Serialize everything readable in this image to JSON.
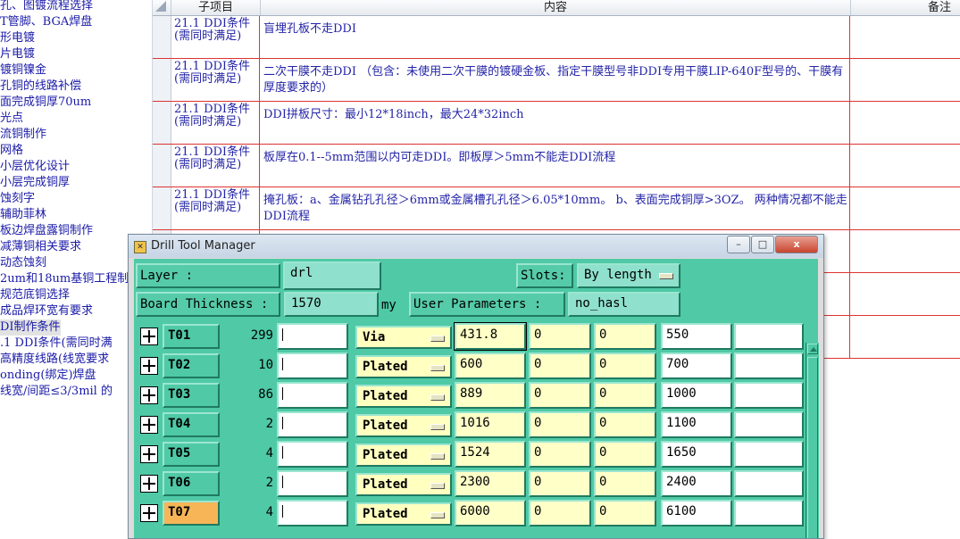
{
  "left_tree": {
    "items": [
      "孔、图镀流程选择",
      "T管脚、BGA焊盘",
      "形电镀",
      "片电镀",
      "镀铜镍金",
      "孔铜的线路补偿",
      "面完成铜厚70um",
      "光点",
      "流铜制作",
      "网格",
      "小层优化设计",
      "小层完成铜厚",
      "蚀刻字",
      "辅助菲林",
      "板边焊盘露铜制作",
      "减薄铜相关要求",
      "动态蚀刻",
      "2um和18um基铜工程制",
      "规范底铜选择",
      "成品焊环宽有要求",
      "DI制作条件",
      ".1 DDI条件(需同时满",
      "高精度线路(线宽要求",
      "onding(绑定)焊盘",
      "线宽/间距≤3/3mil 的"
    ]
  },
  "doc_table": {
    "headers": {
      "subitem": "子项目",
      "content": "内容",
      "remark": "备注"
    },
    "rows": [
      {
        "subitem": "21.1 DDI条件(需同时满足)",
        "content": "盲埋孔板不走DDI"
      },
      {
        "subitem": "21.1 DDI条件(需同时满足)",
        "content": "二次干膜不走DDI （包含：未使用二次干膜的镀硬金板、指定干膜型号非DDI专用干膜LIP-640F型号的、干膜有厚度要求的）"
      },
      {
        "subitem": "21.1 DDI条件(需同时满足)",
        "content": "DDI拼板尺寸：最小12*18inch，最大24*32inch"
      },
      {
        "subitem": "21.1 DDI条件(需同时满足)",
        "content": "板厚在0.1--5mm范围以内可走DDI。即板厚＞5mm不能走DDI流程"
      },
      {
        "subitem": "21.1 DDI条件(需同时满足)",
        "content": "掩孔板：a、金属钻孔孔径＞6mm或金属槽孔孔径＞6.05*10mm。 b、表面完成铜厚>3OZ。 两种情况都不能走DDI流程"
      }
    ]
  },
  "dialog": {
    "title": "Drill Tool Manager",
    "window_buttons": {
      "minimize": "–",
      "maximize": "□",
      "close": "x"
    },
    "layer_label": "Layer          :",
    "layer_value": "drl",
    "slots_label": "Slots:",
    "slots_value": "By length",
    "board_thickness_label": "Board Thickness :",
    "board_thickness_value": "1570",
    "board_thickness_unit": "my",
    "user_params_label": "User Parameters :",
    "user_params_value": "no_hasl",
    "tools": [
      {
        "name": "T01",
        "count": "299",
        "type": "Via",
        "size": "431.8",
        "p1": "0",
        "p2": "0",
        "finish": "550"
      },
      {
        "name": "T02",
        "count": "10",
        "type": "Plated",
        "size": "600",
        "p1": "0",
        "p2": "0",
        "finish": "700"
      },
      {
        "name": "T03",
        "count": "86",
        "type": "Plated",
        "size": "889",
        "p1": "0",
        "p2": "0",
        "finish": "1000"
      },
      {
        "name": "T04",
        "count": "2",
        "type": "Plated",
        "size": "1016",
        "p1": "0",
        "p2": "0",
        "finish": "1100"
      },
      {
        "name": "T05",
        "count": "4",
        "type": "Plated",
        "size": "1524",
        "p1": "0",
        "p2": "0",
        "finish": "1650"
      },
      {
        "name": "T06",
        "count": "2",
        "type": "Plated",
        "size": "2300",
        "p1": "0",
        "p2": "0",
        "finish": "2400"
      },
      {
        "name": "T07",
        "count": "4",
        "type": "Plated",
        "size": "6000",
        "p1": "0",
        "p2": "0",
        "finish": "6100"
      }
    ],
    "colors": {
      "teal": "#4fc9a6",
      "selected_tool": "#f7b557",
      "yellow_field": "#ffffc8"
    }
  }
}
